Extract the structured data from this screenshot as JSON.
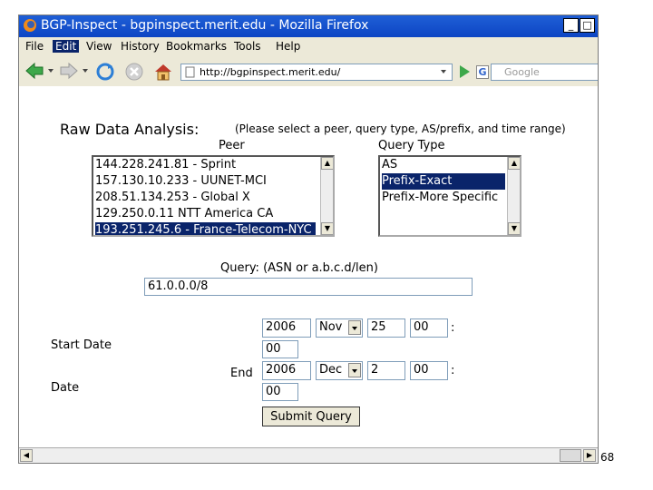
{
  "window": {
    "title": "BGP-Inspect - bgpinspect.merit.edu - Mozilla Firefox"
  },
  "menu": [
    "File",
    "Edit",
    "View",
    "History",
    "Bookmarks",
    "Tools",
    "Help"
  ],
  "toolbar": {
    "url": "http://bgpinspect.merit.edu/",
    "search_placeholder": "Google",
    "search_engine_letter": "G"
  },
  "form": {
    "heading": "Raw Data Analysis:",
    "instruction": "(Please select a peer, query type, AS/prefix, and time range)",
    "peer_label": "Peer",
    "peers": [
      "144.228.241.81 - Sprint",
      "157.130.10.233 - UUNET-MCI",
      "208.51.134.253 - Global X",
      "129.250.0.11   NTT America CA",
      "193.251.245.6 - France-Telecom-NYC"
    ],
    "peer_selected": 4,
    "query_type_label": "Query Type",
    "query_types": [
      "AS",
      "Prefix-Exact",
      "Prefix-More Specific"
    ],
    "query_type_selected": 1,
    "query_label": "Query: (ASN or a.b.c.d/len)",
    "query_value": "61.0.0.0/8",
    "start_label_1": "Start Date",
    "start_year": "2006",
    "start_month": "Nov",
    "start_day": "25",
    "start_hour": "00",
    "start_minute": "00",
    "end_label_1": "End",
    "end_label_2": "Date",
    "end_year": "2006",
    "end_month": "Dec",
    "end_day": "2",
    "end_hour": "00",
    "end_minute": "00",
    "time_sep": ":",
    "submit_label": "Submit Query"
  },
  "page_number": "68",
  "colors": {
    "titlebar": "#0d45c4",
    "selection": "#0a246a",
    "chrome": "#ece9d8"
  }
}
